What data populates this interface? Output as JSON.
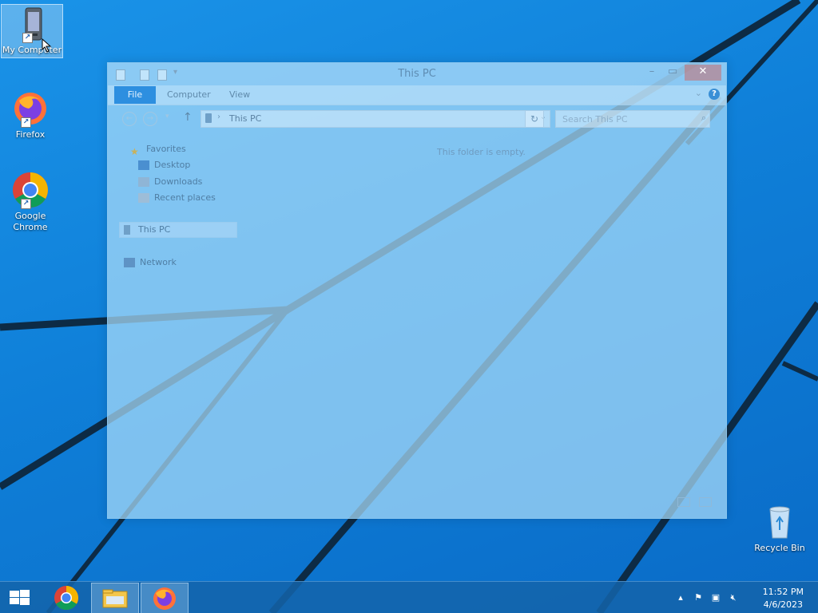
{
  "desktop": {
    "icons": [
      {
        "label": "My Computer",
        "icon": "my-computer-icon"
      },
      {
        "label": "Firefox",
        "icon": "firefox-icon"
      },
      {
        "label": "Google Chrome",
        "icon": "chrome-icon"
      },
      {
        "label": "Recycle Bin",
        "icon": "recycle-bin-icon"
      }
    ]
  },
  "explorer": {
    "title": "This PC",
    "ribbon": {
      "file_tab": "File",
      "tabs": [
        "Computer",
        "View"
      ],
      "help_glyph": "?"
    },
    "address": {
      "path": "This PC"
    },
    "search": {
      "placeholder": "Search This PC"
    },
    "nav": {
      "favorites": "Favorites",
      "desktop": "Desktop",
      "downloads": "Downloads",
      "recent": "Recent places",
      "this_pc": "This PC",
      "network": "Network"
    },
    "empty_message": "This folder is empty."
  },
  "taskbar": {
    "pinned": [
      {
        "name": "Google Chrome",
        "icon": "chrome-icon",
        "active": false
      },
      {
        "name": "File Explorer",
        "icon": "file-explorer-icon",
        "active": true
      },
      {
        "name": "Firefox",
        "icon": "firefox-icon",
        "active": false
      }
    ],
    "tray": {
      "time": "11:52 PM",
      "date": "4/6/2023",
      "icons": [
        "show-hidden-icons-icon",
        "action-center-flag-icon",
        "network-icon",
        "volume-muted-icon"
      ]
    }
  },
  "colors": {
    "desktop_blue": "#0f7fd8",
    "accent": "#2d8fe0",
    "taskbar": "#1464aa"
  }
}
